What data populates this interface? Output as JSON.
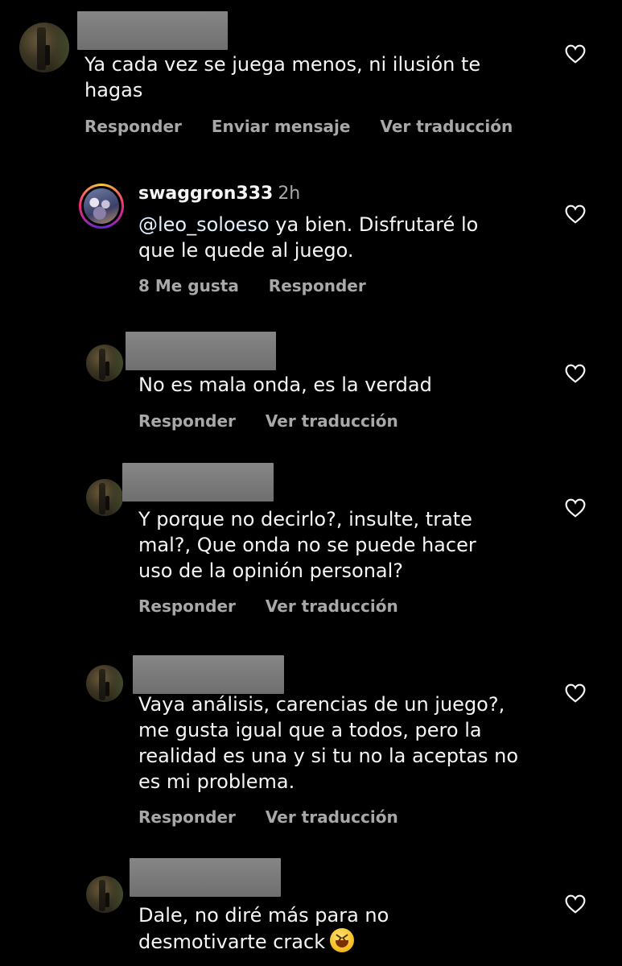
{
  "comments": [
    {
      "text_lines": [
        "Ya cada vez se juega menos, ni ilusión te",
        "hagas"
      ],
      "actions": [
        "Responder",
        "Enviar mensaje",
        "Ver traducción"
      ]
    },
    {
      "username": "swaggron333",
      "time": "2h",
      "mention": "@leo_soloeso",
      "text_lines": [
        " ya bien. Disfrutaré lo",
        "que le quede al juego."
      ],
      "actions": [
        "8 Me gusta",
        "Responder"
      ]
    },
    {
      "text_lines": [
        "No es mala onda, es la verdad"
      ],
      "actions": [
        "Responder",
        "Ver traducción"
      ]
    },
    {
      "text_lines": [
        "Y porque no decirlo?, insulte, trate",
        "mal?, Que onda no se puede hacer",
        "uso de la opinión personal?"
      ],
      "actions": [
        "Responder",
        "Ver traducción"
      ]
    },
    {
      "text_lines": [
        "Vaya análisis, carencias de un juego?,",
        "me gusta igual que a todos, pero la",
        "realidad es una y si tu no la aceptas no",
        "es mi problema."
      ],
      "actions": [
        "Responder",
        "Ver traducción"
      ]
    },
    {
      "text_lines": [
        "Dale, no diré más para no",
        "desmotivarte crack"
      ],
      "emoji": "grinning-squinting-face",
      "actions": []
    }
  ],
  "icons": {
    "like": "heart-outline-icon"
  },
  "colors": {
    "background": "#000000",
    "text": "#f5f5f5",
    "secondary": "#a8a8a8",
    "redaction": "#7a7a7a"
  }
}
